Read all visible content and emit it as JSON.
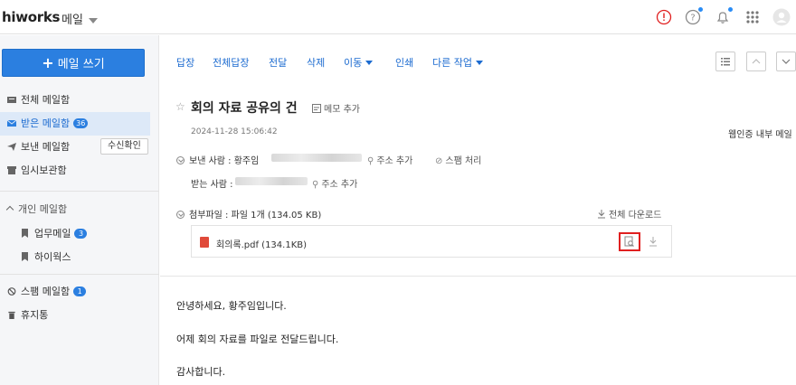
{
  "app": {
    "logo": "hiworks",
    "current_app": "메일"
  },
  "colors": {
    "accent": "#2b7fe0",
    "alert": "#e02020",
    "notify_dot": "#2a8cf5"
  },
  "top_icons": [
    "alert-circle-icon",
    "help-icon",
    "bell-icon",
    "apps-grid-icon",
    "avatar"
  ],
  "sidebar": {
    "compose_label": "메일 쓰기",
    "items": [
      {
        "label": "전체 메일함",
        "icon": "inbox-icon"
      },
      {
        "label": "받은 메일함",
        "icon": "mail-icon",
        "badge": "36"
      },
      {
        "label": "보낸 메일함",
        "icon": "send-icon",
        "button": "수신확인"
      },
      {
        "label": "임시보관함",
        "icon": "draft-icon"
      }
    ],
    "personal_section": "개인 메일함",
    "personal_items": [
      {
        "label": "업무메일",
        "badge": "3"
      },
      {
        "label": "하이웍스"
      }
    ],
    "bottom_items": [
      {
        "label": "스팸 메일함",
        "icon": "spam-icon",
        "badge": "1"
      },
      {
        "label": "휴지통",
        "icon": "trash-icon"
      }
    ]
  },
  "toolbar": {
    "buttons": [
      "답장",
      "전체답장",
      "전달",
      "삭제",
      "이동",
      "인쇄",
      "다른 작업"
    ]
  },
  "message": {
    "subject": "회의 자료 공유의 건",
    "memo_add": "메모 추가",
    "date": "2024-11-28 15:06:42",
    "auth_note": "웹인증 내부 메일",
    "from_label": "보낸 사람 : 황주임",
    "to_label": "받는 사람 :",
    "address_add": "주소 추가",
    "spam_action": "스팸 처리",
    "attachment_summary": "첨부파일 : 파일 1개 (134.05 KB)",
    "download_all": "전체 다운로드",
    "attachment_name": "회의록.pdf (134.1KB)",
    "body": [
      "안녕하세요, 황주임입니다.",
      "어제 회의 자료를 파일로 전달드립니다.",
      "감사합니다."
    ]
  }
}
